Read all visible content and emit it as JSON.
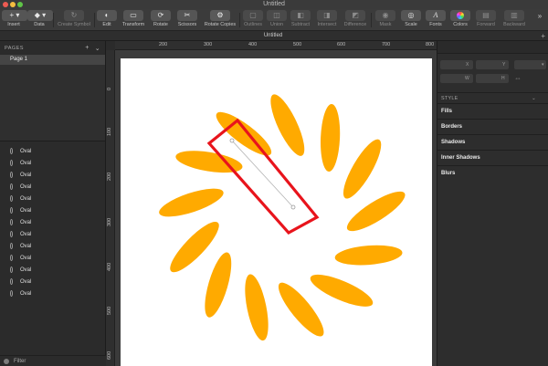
{
  "window": {
    "title": "Untitled"
  },
  "toolbar": {
    "insert": "Insert",
    "data": "Data",
    "create_symbol": "Create Symbol",
    "edit": "Edit",
    "transform": "Transform",
    "rotate": "Rotate",
    "scissors": "Scissors",
    "rotate_copies": "Rotate Copies",
    "outlines": "Outlines",
    "union": "Union",
    "subtract": "Subtract",
    "intersect": "Intersect",
    "difference": "Difference",
    "mask": "Mask",
    "scale": "Scale",
    "fonts": "Fonts",
    "colors": "Colors",
    "forward": "Forward",
    "backward": "Backward",
    "overflow": "»"
  },
  "tab": {
    "label": "Untitled"
  },
  "pages": {
    "header": "PAGES",
    "items": [
      {
        "label": "Page 1"
      }
    ]
  },
  "layers": [
    {
      "label": "Oval"
    },
    {
      "label": "Oval"
    },
    {
      "label": "Oval"
    },
    {
      "label": "Oval"
    },
    {
      "label": "Oval"
    },
    {
      "label": "Oval"
    },
    {
      "label": "Oval"
    },
    {
      "label": "Oval"
    },
    {
      "label": "Oval"
    },
    {
      "label": "Oval"
    },
    {
      "label": "Oval"
    },
    {
      "label": "Oval"
    },
    {
      "label": "Oval"
    }
  ],
  "filter": {
    "label": "Filter"
  },
  "ruler": {
    "top": [
      "200",
      "300",
      "400",
      "500",
      "600",
      "700",
      "800"
    ],
    "left": [
      "0",
      "100",
      "200",
      "300",
      "400",
      "500",
      "600"
    ]
  },
  "inspector": {
    "x_label": "X",
    "y_label": "Y",
    "w_label": "W",
    "h_label": "H",
    "style_header": "STYLE",
    "sections": {
      "fills": "Fills",
      "borders": "Borders",
      "shadows": "Shadows",
      "inner_shadows": "Inner Shadows",
      "blurs": "Blurs"
    }
  },
  "colors": {
    "petal": "#FFAA00",
    "highlight": "#E8141C",
    "artboard": "#FFFFFF"
  }
}
